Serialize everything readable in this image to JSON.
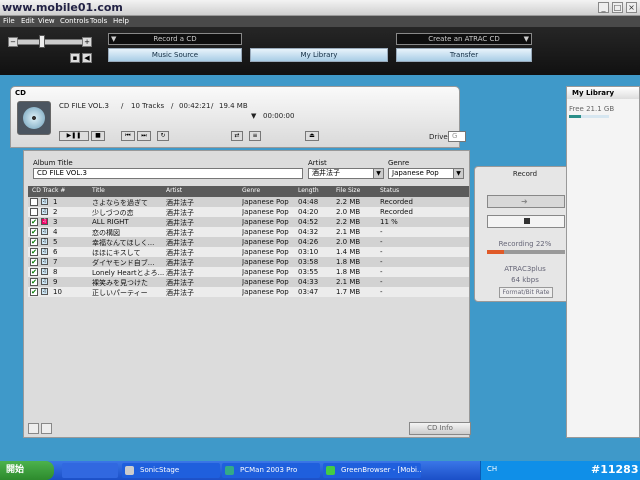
{
  "watermark": "www.mobile01.com",
  "menu": [
    "File",
    "Edit",
    "View",
    "Controls",
    "Tools",
    "Help"
  ],
  "top": {
    "record_field": "Record a CD",
    "atrac_field": "Create an ATRAC CD",
    "tabs": [
      "Music Source",
      "My Library",
      "Transfer"
    ]
  },
  "cd": {
    "label": "CD",
    "title": "CD FILE VOL.3",
    "tracks": "10 Tracks",
    "duration": "00:42:21",
    "size": "19.4 MB",
    "elapsed": "00:00:00",
    "drive_label": "Drive:",
    "drive_value": "G"
  },
  "album": {
    "title_label": "Album Title",
    "title_value": "CD FILE VOL.3",
    "artist_label": "Artist",
    "artist_value": "酒井法子",
    "genre_label": "Genre",
    "genre_value": "Japanese Pop"
  },
  "columns": [
    "CD Track #",
    "Title",
    "Artist",
    "Genre",
    "Length",
    "File Size",
    "Status"
  ],
  "tracks": [
    {
      "n": "1",
      "title": "さよならを過ぎて",
      "artist": "酒井法子",
      "genre": "Japanese Pop",
      "len": "04:48",
      "size": "2.2 MB",
      "status": "Recorded",
      "checked": false,
      "recording": false
    },
    {
      "n": "2",
      "title": "少しづつの恋",
      "artist": "酒井法子",
      "genre": "Japanese Pop",
      "len": "04:20",
      "size": "2.0 MB",
      "status": "Recorded",
      "checked": false,
      "recording": false
    },
    {
      "n": "3",
      "title": "ALL RIGHT",
      "artist": "酒井法子",
      "genre": "Japanese Pop",
      "len": "04:52",
      "size": "2.2 MB",
      "status": "11 %",
      "checked": true,
      "recording": true
    },
    {
      "n": "4",
      "title": "恋の構図",
      "artist": "酒井法子",
      "genre": "Japanese Pop",
      "len": "04:32",
      "size": "2.1 MB",
      "status": "-",
      "checked": true,
      "recording": false
    },
    {
      "n": "5",
      "title": "幸福なんてほしく...",
      "artist": "酒井法子",
      "genre": "Japanese Pop",
      "len": "04:26",
      "size": "2.0 MB",
      "status": "-",
      "checked": true,
      "recording": false
    },
    {
      "n": "6",
      "title": "ほほにキスして",
      "artist": "酒井法子",
      "genre": "Japanese Pop",
      "len": "03:10",
      "size": "1.4 MB",
      "status": "-",
      "checked": true,
      "recording": false
    },
    {
      "n": "7",
      "title": "ダイヤモンド自ブ...",
      "artist": "酒井法子",
      "genre": "Japanese Pop",
      "len": "03:58",
      "size": "1.8 MB",
      "status": "-",
      "checked": true,
      "recording": false
    },
    {
      "n": "8",
      "title": "Lonely Heartとよろ...",
      "artist": "酒井法子",
      "genre": "Japanese Pop",
      "len": "03:55",
      "size": "1.8 MB",
      "status": "-",
      "checked": true,
      "recording": false
    },
    {
      "n": "9",
      "title": "裸笑みを見つけた",
      "artist": "酒井法子",
      "genre": "Japanese Pop",
      "len": "04:33",
      "size": "2.1 MB",
      "status": "-",
      "checked": true,
      "recording": false
    },
    {
      "n": "10",
      "title": "正しいパーティー",
      "artist": "酒井法子",
      "genre": "Japanese Pop",
      "len": "03:47",
      "size": "1.7 MB",
      "status": "-",
      "checked": true,
      "recording": false
    }
  ],
  "cd_info_button": "CD Info",
  "record": {
    "label": "Record",
    "status": "Recording 22%",
    "progress": 0.22,
    "format": "ATRAC3plus",
    "bitrate": "64 kbps",
    "format_button": "Format/Bit Rate"
  },
  "library": {
    "title": "My Library",
    "free": "Free 21.1  GB",
    "used_fraction": 0.3
  },
  "taskbar": {
    "start": "開始",
    "tasks": [
      "SonicStage",
      "PCMan 2003 Pro",
      "GreenBrowser - [Mobi..."
    ],
    "tray_lang": "CH",
    "tray_code": "#11283"
  },
  "colors": {
    "accent": "#3f99c9",
    "recording": "#e05a28",
    "taskbar": "#1b4fc7"
  }
}
